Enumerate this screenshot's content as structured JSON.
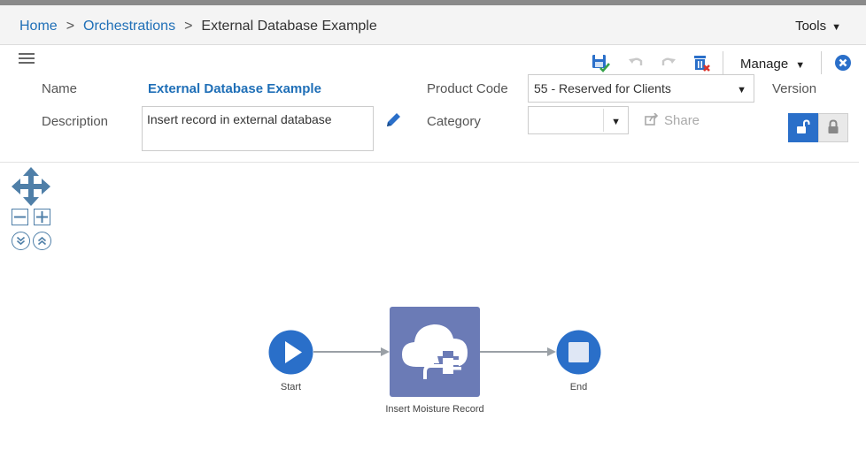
{
  "breadcrumb": {
    "home": "Home",
    "orchestrations": "Orchestrations",
    "current": "External Database Example",
    "separator": ">"
  },
  "header": {
    "tools_label": "Tools"
  },
  "toolbar": {
    "manage_label": "Manage"
  },
  "form": {
    "name_label": "Name",
    "name_value": "External Database Example",
    "description_label": "Description",
    "description_value": "Insert record in external database",
    "product_code_label": "Product Code",
    "product_code_value": "55 - Reserved for Clients",
    "version_label": "Version",
    "category_label": "Category",
    "category_value": "",
    "share_label": "Share"
  },
  "flow": {
    "start_label": "Start",
    "step_label": "Insert Moisture Record",
    "end_label": "End"
  },
  "colors": {
    "link": "#1f6fb7",
    "node_blue": "#2a6fc9",
    "step_purple": "#6b7bb6",
    "lock_active": "#2a6fc9",
    "icon_teal": "#4f7fa8"
  }
}
